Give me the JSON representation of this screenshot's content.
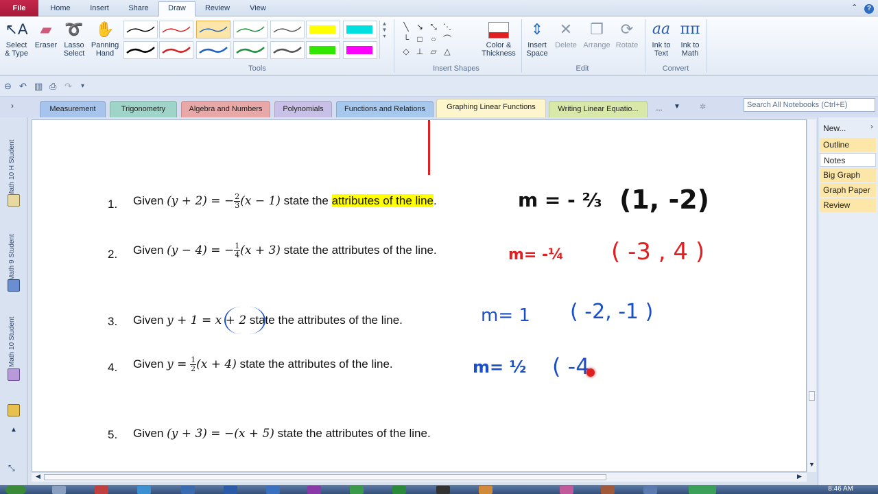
{
  "menu": {
    "file": "File",
    "tabs": [
      "Home",
      "Insert",
      "Share",
      "Draw",
      "Review",
      "View"
    ],
    "active_tab": "Draw"
  },
  "ribbon": {
    "tools": {
      "select_type": "Select\n& Type",
      "eraser": "Eraser",
      "lasso_select": "Lasso\nSelect",
      "panning_hand": "Panning\nHand",
      "label": "Tools"
    },
    "insert_shapes_label": "Insert Shapes",
    "color_thickness": "Color &\nThickness",
    "edit": {
      "insert_space": "Insert\nSpace",
      "delete": "Delete",
      "arrange": "Arrange",
      "rotate": "Rotate",
      "label": "Edit"
    },
    "convert": {
      "ink_to_text": "Ink to\nText",
      "ink_to_math": "Ink to\nMath",
      "label": "Convert"
    },
    "pen_colors": [
      "#000000",
      "#d42020",
      "#2060c0",
      "#209040",
      "#555555",
      "#ffff00",
      "#00e0e0",
      "#000000",
      "#d42020",
      "#2060c0",
      "#209040",
      "#555555",
      "#33e600",
      "#ff00ff"
    ]
  },
  "sections": [
    {
      "label": "Measurement",
      "color": "#a7c4ec"
    },
    {
      "label": "Trigonometry",
      "color": "#9fd4c9"
    },
    {
      "label": "Algebra and Numbers",
      "color": "#e8a8a8"
    },
    {
      "label": "Polynomials",
      "color": "#c8c0e6"
    },
    {
      "label": "Functions and Relations",
      "color": "#a6c8ec"
    },
    {
      "label": "Graphing Linear Functions",
      "color": "#fdf6cc"
    },
    {
      "label": "Writing Linear Equatio...",
      "color": "#d8e8a8"
    },
    {
      "label": "...",
      "color": "#d4def0"
    }
  ],
  "search": {
    "placeholder": "Search All Notebooks (Ctrl+E)"
  },
  "notebooks": [
    "Math 10 H Student",
    "Math 9 Student",
    "Math 10 Student"
  ],
  "questions": [
    {
      "num": "1.",
      "given": "Given",
      "rest": "state the",
      "highlight": "attributes of the line",
      "end": "."
    },
    {
      "num": "2.",
      "given": "Given",
      "rest": "state the attributes of the line."
    },
    {
      "num": "3.",
      "given": "Given",
      "rest": "state the attributes of the line."
    },
    {
      "num": "4.",
      "given": "Given",
      "rest": "state the attributes of the line."
    },
    {
      "num": "5.",
      "given": "Given",
      "rest": "state the attributes of the line."
    }
  ],
  "math": {
    "q1": {
      "lhs": "(y + 2) = −",
      "num": "2",
      "den": "3",
      "rhs": "(x − 1)"
    },
    "q2": {
      "lhs": "(y − 4) = −",
      "num": "1",
      "den": "4",
      "rhs": "(x + 3)"
    },
    "q3": {
      "expr": "y + 1 = x + 2"
    },
    "q4": {
      "lhs": "y =",
      "num": "1",
      "den": "2",
      "rhs": "(x + 4)"
    },
    "q5": {
      "expr": "(y + 3) = −(x + 5)"
    }
  },
  "ink": {
    "a1_m": "m = - ⅔",
    "a1_pt": "(1, -2)",
    "a2_m": "m= -¼",
    "a2_pt": "( -3 , 4 )",
    "a3_m": "m= 1",
    "a3_pt": "( -2, -1 )",
    "a4_m": "m= ½",
    "a4_pt": "( -4"
  },
  "ink_colors": {
    "black": "#111111",
    "red": "#e02020",
    "blue": "#1a4fc8"
  },
  "pages": [
    {
      "label": "New...",
      "color": "#e6edf7"
    },
    {
      "label": "Outline",
      "color": "#fde7a8"
    },
    {
      "label": "Notes",
      "color": "#ffffff"
    },
    {
      "label": "Big Graph",
      "color": "#fde7a8"
    },
    {
      "label": "Graph Paper",
      "color": "#fde7a8"
    },
    {
      "label": "Review",
      "color": "#fde7a8"
    }
  ],
  "clock": "8:46 AM"
}
